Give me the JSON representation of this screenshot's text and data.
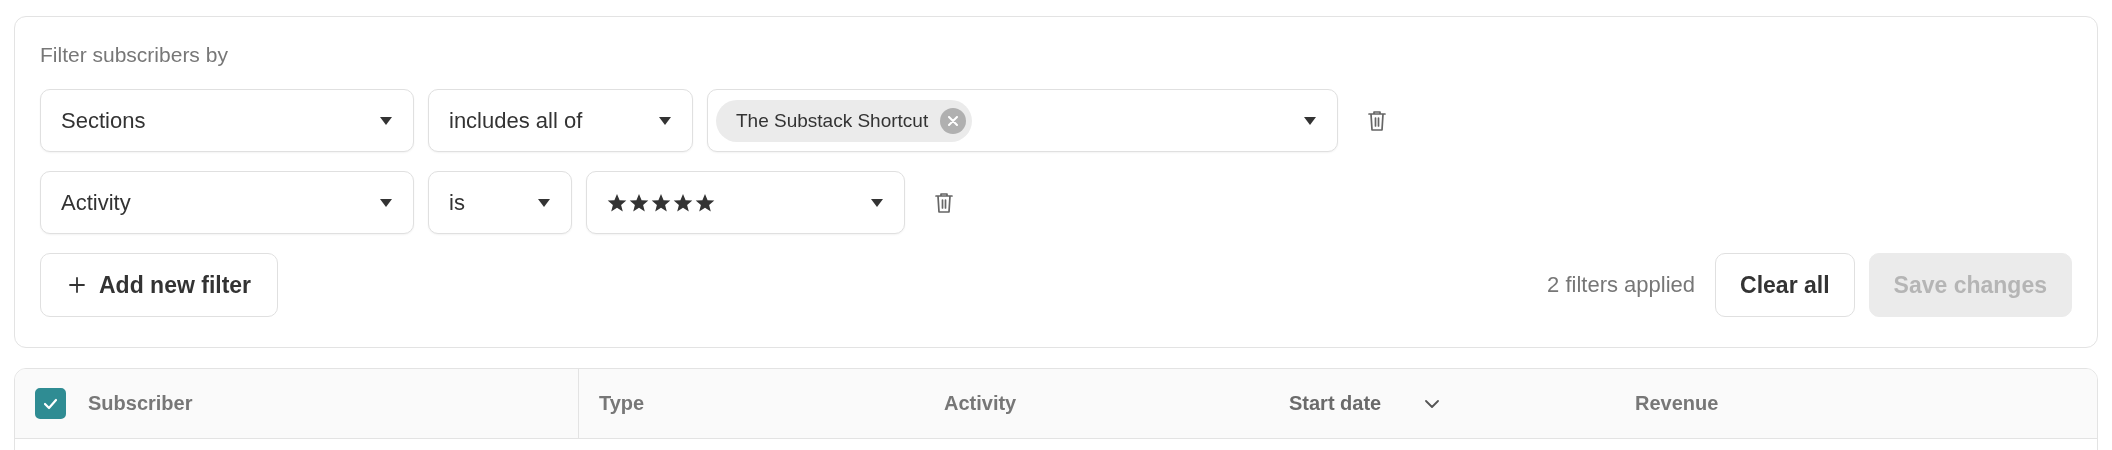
{
  "filter_panel": {
    "title": "Filter subscribers by",
    "filters": [
      {
        "field": "Sections",
        "operator": "includes all of",
        "kind": "chips",
        "chips": [
          "The Substack Shortcut"
        ]
      },
      {
        "field": "Activity",
        "operator": "is",
        "kind": "stars",
        "stars": 5
      }
    ],
    "add_button": "Add new filter",
    "applied_count": "2 filters applied",
    "clear_button": "Clear all",
    "save_button": {
      "label": "Save changes",
      "disabled": true
    }
  },
  "table": {
    "select_all": {
      "checked": true
    },
    "columns": [
      {
        "label": "Subscriber",
        "sorted": false
      },
      {
        "label": "Type",
        "sorted": false
      },
      {
        "label": "Activity",
        "sorted": false
      },
      {
        "label": "Start date",
        "sorted": true
      },
      {
        "label": "Revenue",
        "sorted": false
      }
    ]
  }
}
